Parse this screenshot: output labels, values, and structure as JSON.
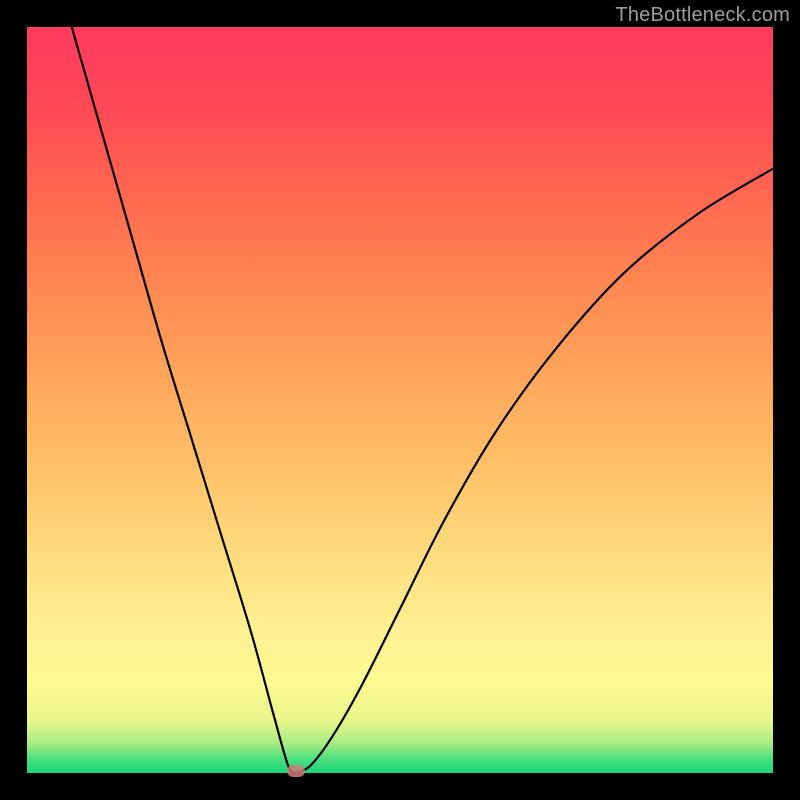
{
  "watermark": "TheBottleneck.com",
  "colors": {
    "background": "#000000",
    "curve": "#000000",
    "marker": "#d07a78",
    "watermark": "#9d9d9d"
  },
  "chart_data": {
    "type": "line",
    "title": "",
    "xlabel": "",
    "ylabel": "",
    "xlim": [
      0,
      100
    ],
    "ylim": [
      0,
      100
    ],
    "grid": false,
    "legend": false,
    "optimum_x": 36,
    "optimum_y": 0,
    "series": [
      {
        "name": "left-branch",
        "x": [
          6,
          10,
          14,
          18,
          22,
          26,
          30,
          33,
          35,
          36
        ],
        "y": [
          100,
          86,
          72,
          58,
          45,
          32,
          19,
          8,
          1,
          0
        ]
      },
      {
        "name": "right-branch",
        "x": [
          36,
          38,
          41,
          45,
          50,
          56,
          63,
          71,
          80,
          90,
          100
        ],
        "y": [
          0,
          1,
          5,
          12,
          22,
          34,
          46,
          57,
          67,
          75,
          81
        ]
      }
    ]
  }
}
